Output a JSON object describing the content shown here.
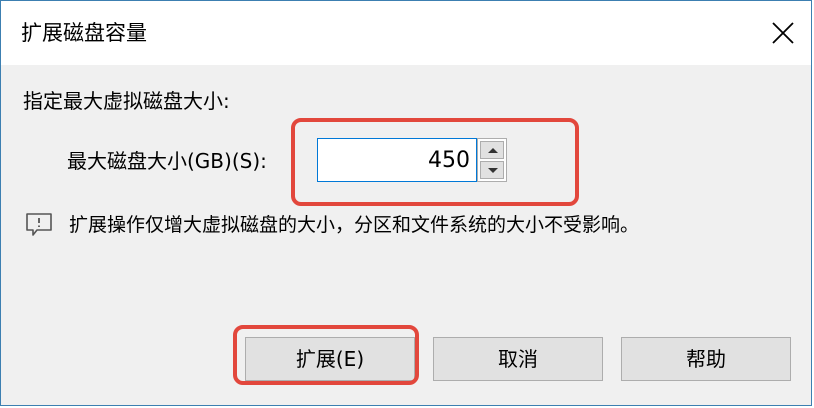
{
  "dialog": {
    "title": "扩展磁盘容量",
    "close_icon": "close-icon"
  },
  "content": {
    "section_label": "指定最大虚拟磁盘大小:",
    "size_label": "最大磁盘大小(GB)(S):",
    "size_value": "450",
    "spinner_icons": [
      "chevron-up-icon",
      "chevron-down-icon"
    ],
    "info_icon": "comment-icon",
    "info_text": "扩展操作仅增大虚拟磁盘的大小，分区和文件系统的大小不受影响。"
  },
  "buttons": {
    "extend_label": "扩展(E)",
    "cancel_label": "取消",
    "help_label": "帮助"
  },
  "colors": {
    "highlight": "#e2473c",
    "input_focus_border": "#0078d7",
    "dialog_background": "#f0f0f0"
  }
}
